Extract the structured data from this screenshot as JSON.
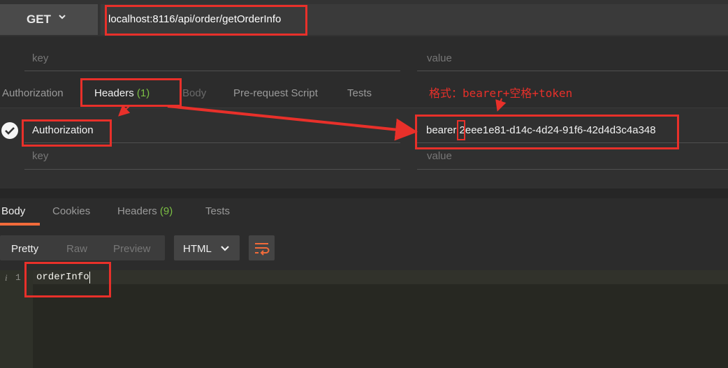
{
  "request": {
    "method": "GET",
    "url": "localhost:8116/api/order/getOrderInfo"
  },
  "params_row": {
    "key_placeholder": "key",
    "value_placeholder": "value"
  },
  "request_tabs": [
    {
      "label": "Authorization"
    },
    {
      "label": "Headers",
      "count": "(1)"
    },
    {
      "label": "Body"
    },
    {
      "label": "Pre-request Script"
    },
    {
      "label": "Tests"
    }
  ],
  "headers": {
    "row": {
      "key": "Authorization",
      "value": "bearer 2eee1e81-d14c-4d24-91f6-42d4d3c4a348"
    },
    "new_key_placeholder": "key",
    "new_value_placeholder": "value"
  },
  "response_tabs": [
    {
      "label": "Body"
    },
    {
      "label": "Cookies"
    },
    {
      "label": "Headers",
      "count": "(9)"
    },
    {
      "label": "Tests"
    }
  ],
  "view_modes": [
    "Pretty",
    "Raw",
    "Preview"
  ],
  "format_select": "HTML",
  "editor": {
    "line_number": "1",
    "info_icon": "i",
    "line_text": "orderInfo"
  },
  "annotation": {
    "text": "格式：bearer+空格+token"
  },
  "colors": {
    "accent": "#f26b3a",
    "annotation_red": "#e8302a",
    "count_green": "#7bbf44"
  }
}
